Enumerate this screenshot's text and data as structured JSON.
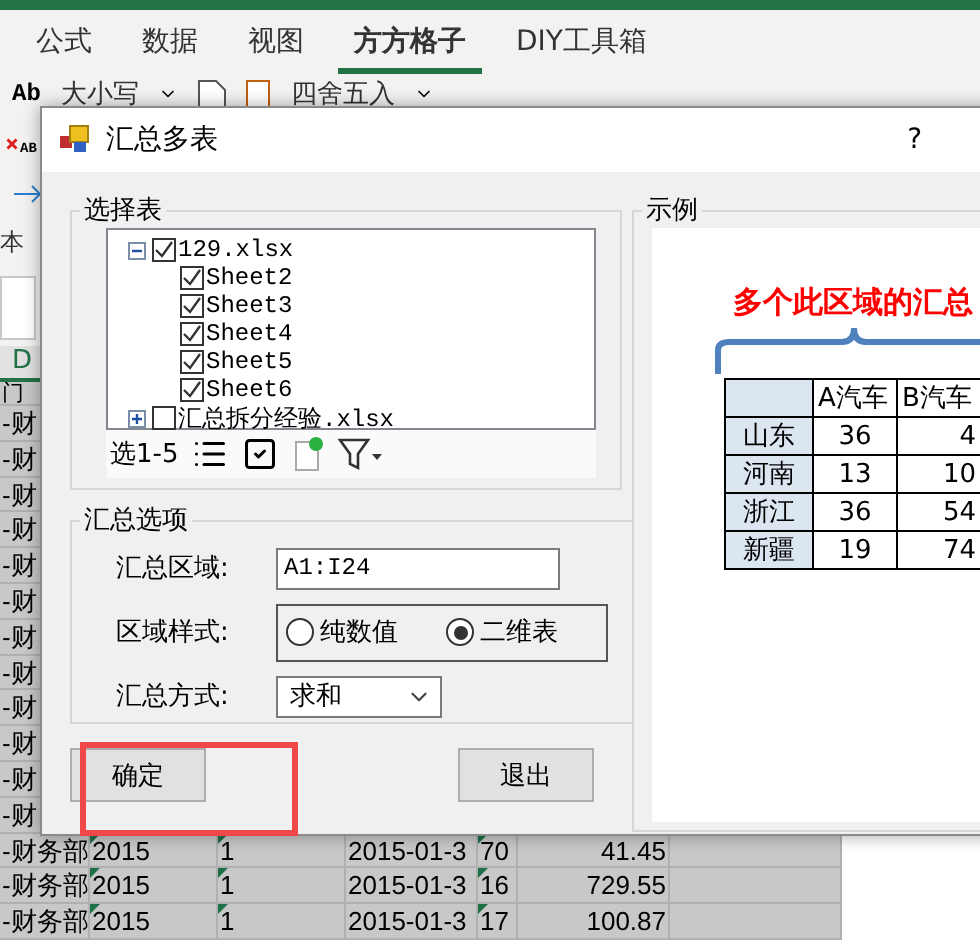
{
  "ribbon": {
    "tabs": [
      {
        "label": "公式",
        "selected": false
      },
      {
        "label": "数据",
        "selected": false
      },
      {
        "label": "视图",
        "selected": false
      },
      {
        "label": "方方格子",
        "selected": true
      },
      {
        "label": "DIY工具箱",
        "selected": false
      }
    ],
    "tool_prefix": "Ab",
    "tools": [
      "大小写",
      "四舍五入"
    ],
    "side_tool": "AB",
    "side_label": "本"
  },
  "sheet": {
    "column_header": "D",
    "header_cell": "门",
    "rows": [
      {
        "cells": [
          "-财"
        ]
      },
      {
        "cells": [
          "-财"
        ]
      },
      {
        "cells": [
          "-财"
        ]
      },
      {
        "cells": [
          "-财"
        ]
      },
      {
        "cells": [
          "-财"
        ]
      },
      {
        "cells": [
          "-财"
        ]
      },
      {
        "cells": [
          "-财"
        ]
      },
      {
        "cells": [
          "-财"
        ]
      },
      {
        "cells": [
          "-财"
        ]
      },
      {
        "cells": [
          "-财"
        ]
      },
      {
        "cells": [
          "-财"
        ]
      },
      {
        "cells": [
          "-财"
        ]
      },
      {
        "cells": [
          "-财务部",
          "2015",
          "1",
          "2015-01-3",
          "70",
          "41.45"
        ]
      },
      {
        "cells": [
          "-财务部",
          "2015",
          "1",
          "2015-01-3",
          "16",
          "729.55"
        ]
      },
      {
        "cells": [
          "-财务部",
          "2015",
          "1",
          "2015-01-3",
          "17",
          "100.87"
        ]
      }
    ]
  },
  "dialog": {
    "title": "汇总多表",
    "help": "?",
    "select_group": {
      "title": "选择表",
      "tree": [
        {
          "label": "129.xlsx",
          "checked": true,
          "expanded": true,
          "children": [
            {
              "label": "Sheet2",
              "checked": true
            },
            {
              "label": "Sheet3",
              "checked": true
            },
            {
              "label": "Sheet4",
              "checked": true
            },
            {
              "label": "Sheet5",
              "checked": true
            },
            {
              "label": "Sheet6",
              "checked": true
            }
          ]
        },
        {
          "label": "汇总拆分经验.xlsx",
          "checked": false,
          "expanded": false
        }
      ],
      "toolbar_label": "选1-5"
    },
    "options_group": {
      "title": "汇总选项",
      "range_label": "汇总区域:",
      "range_value": "A1:I24",
      "style_label": "区域样式:",
      "style_options": [
        {
          "label": "纯数值",
          "selected": false
        },
        {
          "label": "二维表",
          "selected": true
        }
      ],
      "method_label": "汇总方式:",
      "method_value": "求和"
    },
    "buttons": [
      "确定",
      "退出"
    ],
    "example": {
      "title": "示例",
      "caption": "多个此区域的汇总",
      "table": {
        "columns": [
          "",
          "A汽车",
          "B汽车"
        ],
        "rows": [
          [
            "山东",
            "36",
            "4"
          ],
          [
            "河南",
            "13",
            "10"
          ],
          [
            "浙江",
            "36",
            "54"
          ],
          [
            "新疆",
            "19",
            "74"
          ]
        ]
      }
    }
  }
}
